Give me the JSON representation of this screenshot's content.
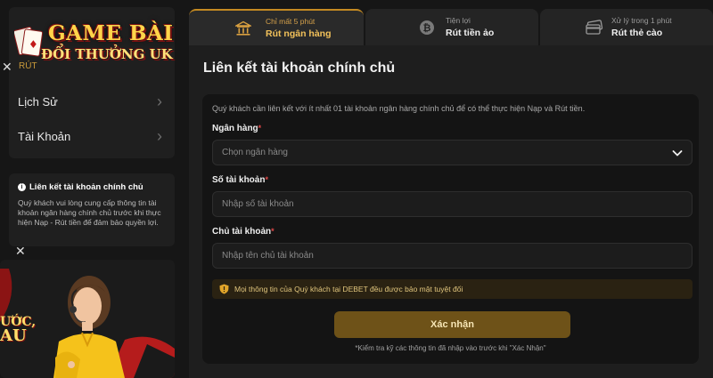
{
  "logo": {
    "line1": "GAME BÀI",
    "line2": "ĐỔI THƯỞNG UK"
  },
  "sidebar": {
    "hidden_item": "RÚT",
    "items": [
      {
        "label": "Lịch Sử"
      },
      {
        "label": "Tài Khoản"
      }
    ]
  },
  "info_box": {
    "title": "Liên kết tài khoản chính chủ",
    "text": "Quý khách vui lòng cung cấp thông tin tài khoản ngân hàng chính chủ trước khi thực hiện Nạp - Rút tiền để đảm bảo quyền lợi."
  },
  "promo": {
    "text_line1": "ƯỚC,",
    "text_line2": "AU"
  },
  "tabs": [
    {
      "sub": "Chỉ mất 5 phút",
      "label": "Rút ngân hàng",
      "icon": "bank-icon",
      "active": true
    },
    {
      "sub": "Tiện lợi",
      "label": "Rút tiền ảo",
      "icon": "bitcoin-icon",
      "active": false
    },
    {
      "sub": "Xử lý trong 1 phút",
      "label": "Rút thẻ cào",
      "icon": "card-icon",
      "active": false
    }
  ],
  "main": {
    "title": "Liên kết tài khoản chính chủ",
    "description": "Quý khách cần liên kết với ít nhất 01 tài khoản ngân hàng chính chủ để có thể thực hiện Nạp và Rút tiền.",
    "fields": {
      "bank": {
        "label": "Ngân hàng",
        "required": "*",
        "value": "Chọn ngân hàng"
      },
      "account_number": {
        "label": "Số tài khoản",
        "required": "*",
        "placeholder": "Nhập số tài khoản"
      },
      "account_holder": {
        "label": "Chủ tài khoản",
        "required": "*",
        "placeholder": "Nhập tên chủ tài khoản"
      }
    },
    "notice": "Mọi thông tin của Quý khách tại DEBET đều được bảo mật tuyệt đối",
    "submit_label": "Xác nhận",
    "footnote": "*Kiểm tra kỹ các thông tin đã nhập vào trước khi \"Xác Nhận\""
  },
  "colors": {
    "accent_gold": "#c48a22",
    "button_bg": "#6e5218",
    "required_red": "#e04848",
    "page_bg": "#161616"
  }
}
